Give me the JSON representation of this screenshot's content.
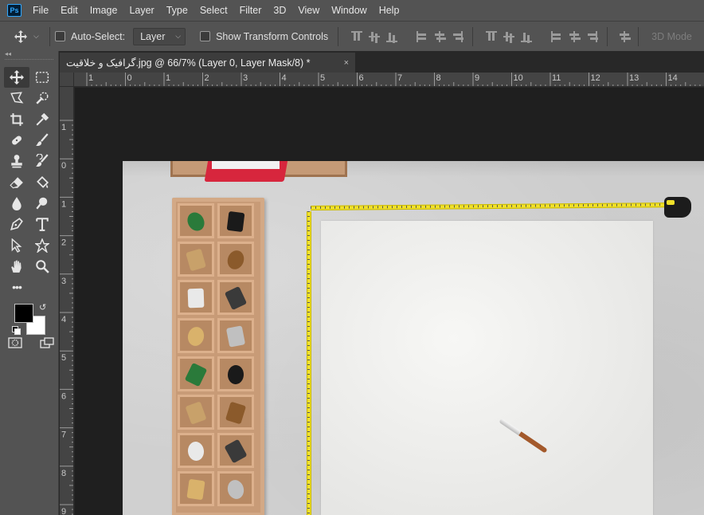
{
  "app": {
    "logo_text": "Ps",
    "menu": [
      "File",
      "Edit",
      "Image",
      "Layer",
      "Type",
      "Select",
      "Filter",
      "3D",
      "View",
      "Window",
      "Help"
    ]
  },
  "options": {
    "auto_select_label": "Auto-Select:",
    "layer_dropdown": "Layer",
    "show_transform_label": "Show Transform Controls",
    "mode_3d_label": "3D Mode"
  },
  "toolbar": {
    "collapse_label": "◂◂",
    "more_tools": "•••",
    "foreground_color": "#000000",
    "background_color": "#ffffff",
    "tools": [
      "move-tool",
      "marquee-tool",
      "lasso-tool",
      "quick-selection-tool",
      "crop-tool",
      "eyedropper-tool",
      "healing-brush-tool",
      "brush-tool",
      "clone-stamp-tool",
      "history-brush-tool",
      "eraser-tool",
      "paint-bucket-tool",
      "blur-tool",
      "dodge-tool",
      "pen-tool",
      "type-tool",
      "path-selection-tool",
      "custom-shape-tool",
      "hand-tool",
      "zoom-tool"
    ]
  },
  "document": {
    "tab_title": "گرافیک و خلاقیت.jpg @ 66/7% (Layer 0, Layer Mask/8) *",
    "tab_close": "×"
  },
  "rulers": {
    "top": [
      "1",
      "0",
      "1",
      "2",
      "3",
      "4",
      "5",
      "6",
      "7",
      "8",
      "9",
      "10",
      "11",
      "12",
      "13",
      "14"
    ],
    "left": [
      "1",
      "0",
      "1",
      "2",
      "3",
      "4",
      "5",
      "6",
      "7",
      "8",
      "9"
    ]
  }
}
